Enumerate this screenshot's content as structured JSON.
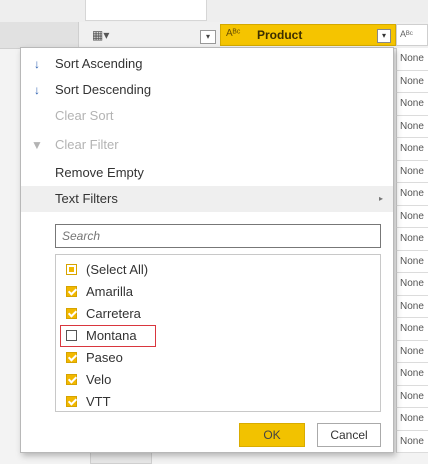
{
  "grid": {
    "product_column": {
      "type_icon": "Aᴮᶜ",
      "name": "Product"
    },
    "next_column": {
      "type_icon": "Aᴮᶜ"
    },
    "cells": [
      "None",
      "None",
      "None",
      "None",
      "None",
      "None",
      "None",
      "None",
      "None",
      "None",
      "None",
      "None",
      "None",
      "None",
      "None",
      "None",
      "None",
      "None"
    ]
  },
  "menu": {
    "items": [
      {
        "icon": "sort-ascending-icon",
        "glyph": "↓",
        "label": "Sort Ascending",
        "enabled": true
      },
      {
        "icon": "sort-descending-icon",
        "glyph": "↓",
        "label": "Sort Descending",
        "enabled": true
      },
      {
        "icon": "",
        "glyph": "",
        "label": "Clear Sort",
        "enabled": false
      },
      {
        "icon": "clear-filter-icon",
        "glyph": "✕",
        "label": "Clear Filter",
        "enabled": false
      },
      {
        "icon": "",
        "glyph": "",
        "label": "Remove Empty",
        "enabled": true
      },
      {
        "icon": "",
        "glyph": "",
        "label": "Text Filters",
        "enabled": true,
        "submenu_arrow": "▸"
      }
    ],
    "search_placeholder": "Search",
    "values": [
      {
        "label": "(Select All)",
        "state": "indeterminate"
      },
      {
        "label": "Amarilla",
        "state": "checked"
      },
      {
        "label": "Carretera",
        "state": "checked"
      },
      {
        "label": "Montana",
        "state": "unchecked"
      },
      {
        "label": "Paseo",
        "state": "checked"
      },
      {
        "label": "Velo",
        "state": "checked"
      },
      {
        "label": "VTT",
        "state": "checked"
      }
    ],
    "ok_label": "OK",
    "cancel_label": "Cancel"
  },
  "colors": {
    "accent": "#f2c200",
    "highlight_box": "#d9363e",
    "column_header": "#f5c400"
  }
}
